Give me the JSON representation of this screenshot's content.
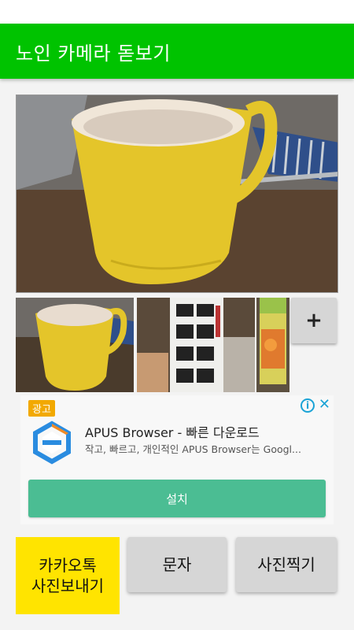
{
  "app": {
    "title": "노인 카메라 돋보기"
  },
  "photos": {
    "main_alt": "coffee-mug-photo",
    "thumbs": [
      "coffee-mug-thumb",
      "sake-bottle-thumb",
      "juice-pack-thumb"
    ],
    "add_label": "+"
  },
  "ad": {
    "label": "광고",
    "title": "APUS Browser - 빠른 다운로드",
    "description": "작고, 빠르고, 개인적인 APUS Browser는 Googl...",
    "install_label": "설치",
    "close_label": "✕",
    "info_label": "i"
  },
  "actions": {
    "kakao_label": "카카오톡\n사진보내기",
    "sms_label": "문자",
    "photo_label": "사진찍기"
  },
  "colors": {
    "app_bar": "#00c300",
    "kakao": "#ffe400",
    "install": "#4bbd93"
  }
}
